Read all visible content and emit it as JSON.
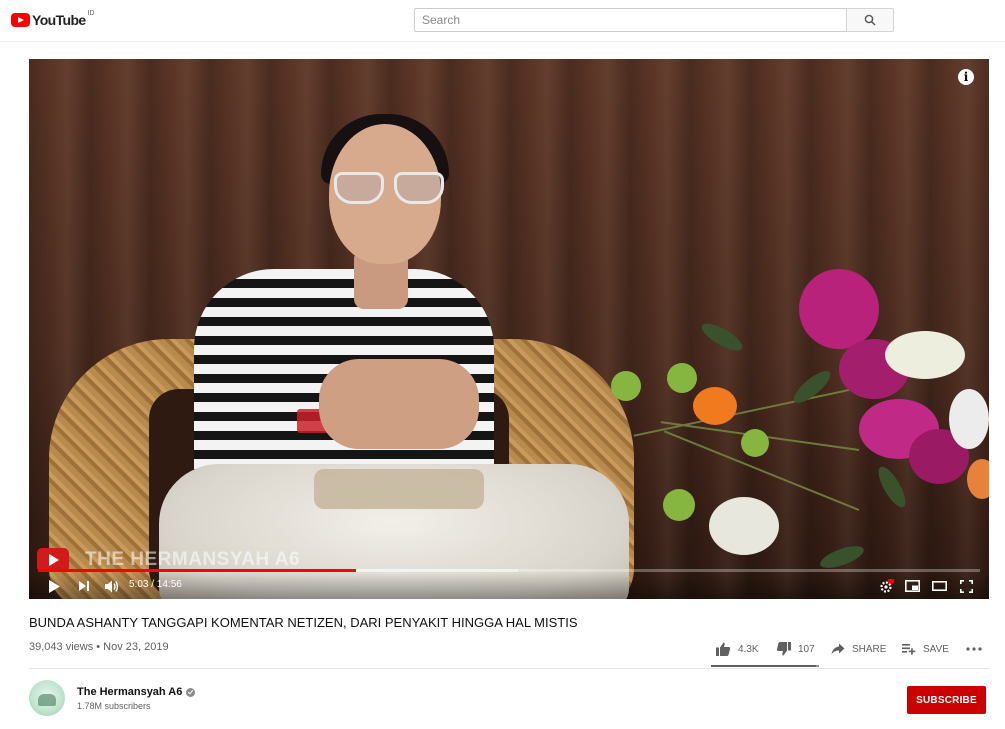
{
  "header": {
    "logo_text": "YouTube",
    "country_code": "ID",
    "search_placeholder": "Search",
    "search_icon": "search-icon"
  },
  "player": {
    "watermark_text": "THE HERMANSYAH A6",
    "current_time": "5:03",
    "duration": "14:56",
    "time_display": "5:03 / 14:56",
    "progress_played_fraction": 0.338,
    "progress_loaded_fraction": 0.51,
    "icons": {
      "play": "play-icon",
      "next": "next-icon",
      "volume": "volume-icon",
      "settings": "settings-hd-icon",
      "miniplayer": "miniplayer-icon",
      "theater": "theater-mode-icon",
      "fullscreen": "fullscreen-icon",
      "info": "info-icon"
    },
    "colors": {
      "progress": "#ff0000"
    }
  },
  "video": {
    "title": "BUNDA ASHANTY TANGGAPI KOMENTAR NETIZEN, DARI PENYAKIT HINGGA HAL MISTIS",
    "views": "39,043 views",
    "date": "Nov 23, 2019",
    "meta_line": "39,043 views • Nov 23, 2019",
    "likes": "4.3K",
    "dislikes": "107",
    "like_ratio": 0.976,
    "share_label": "SHARE",
    "save_label": "SAVE"
  },
  "channel": {
    "name": "The Hermansyah A6",
    "subscribers": "1.78M subscribers",
    "subscribe_label": "SUBSCRIBE",
    "verified": true,
    "colors": {
      "subscribe": "#cc0000"
    }
  }
}
